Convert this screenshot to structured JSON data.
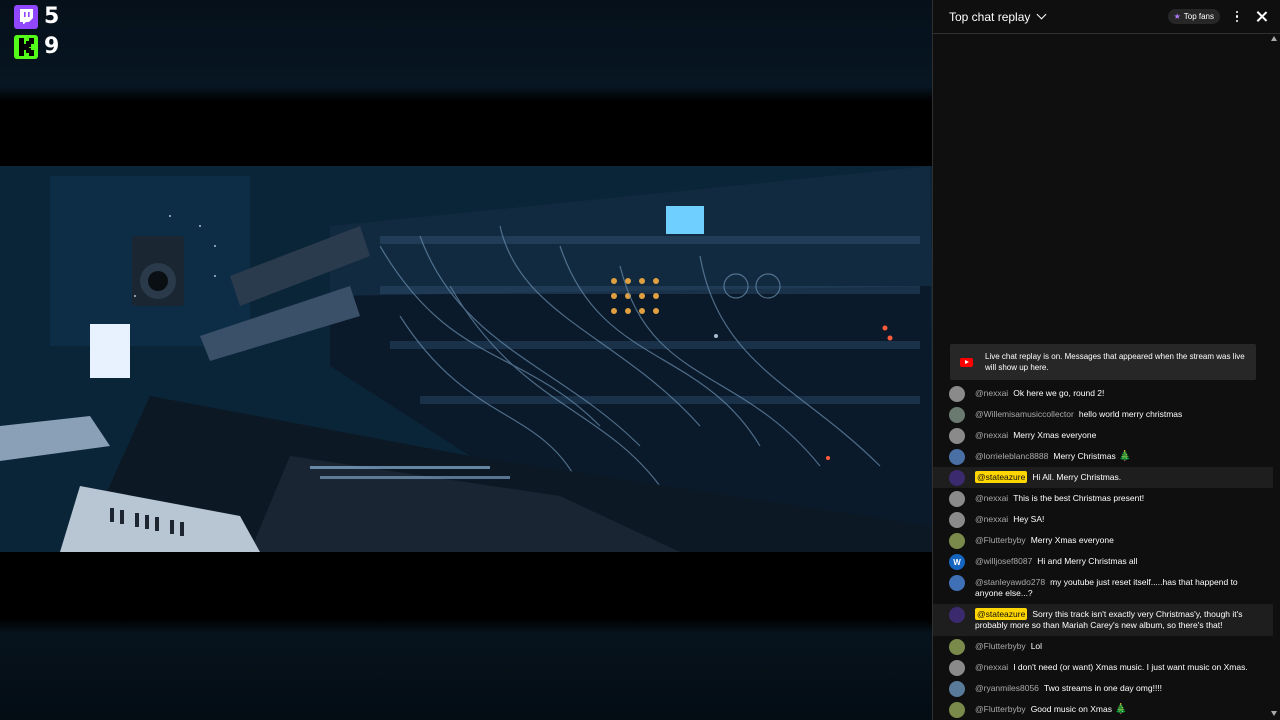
{
  "counters": {
    "twitch": {
      "icon": "twitch-icon",
      "value": "5",
      "color": "#9146ff"
    },
    "kick": {
      "icon": "kick-icon",
      "value": "9",
      "color": "#53fc18"
    }
  },
  "chat": {
    "title": "Top chat replay",
    "top_fans_label": "Top fans",
    "replay_notice": "Live chat replay is on. Messages that appeared when the stream was live will show up here.",
    "messages": [
      {
        "author": "@nexxai",
        "text": "Ok here we go, round 2!",
        "owner": false,
        "tree": false,
        "avatar_color": "#8a8a8a",
        "avatar_letter": ""
      },
      {
        "author": "@Willemisamusiccollector",
        "text": "hello world merry christmas",
        "owner": false,
        "tree": false,
        "avatar_color": "#6b7a70",
        "avatar_letter": ""
      },
      {
        "author": "@nexxai",
        "text": "Merry Xmas everyone",
        "owner": false,
        "tree": false,
        "avatar_color": "#8a8a8a",
        "avatar_letter": ""
      },
      {
        "author": "@lorrieleblanc8888",
        "text": "Merry Christmas",
        "owner": false,
        "tree": true,
        "avatar_color": "#4a6fa5",
        "avatar_letter": ""
      },
      {
        "author": "@stateazure",
        "text": "Hi All. Merry Christmas.",
        "owner": true,
        "tree": false,
        "avatar_color": "#3b2a6e",
        "avatar_letter": ""
      },
      {
        "author": "@nexxai",
        "text": "This is the best Christmas present!",
        "owner": false,
        "tree": false,
        "avatar_color": "#8a8a8a",
        "avatar_letter": ""
      },
      {
        "author": "@nexxai",
        "text": "Hey SA!",
        "owner": false,
        "tree": false,
        "avatar_color": "#8a8a8a",
        "avatar_letter": ""
      },
      {
        "author": "@Flutterbyby",
        "text": "Merry Xmas everyone",
        "owner": false,
        "tree": false,
        "avatar_color": "#7a8a4a",
        "avatar_letter": ""
      },
      {
        "author": "@willjosef8087",
        "text": "Hi and Merry Christmas all",
        "owner": false,
        "tree": false,
        "avatar_color": "#1565c0",
        "avatar_letter": "W"
      },
      {
        "author": "@stanleyawdo278",
        "text": "my youtube just reset itself.....has that happend to anyone else...?",
        "owner": false,
        "tree": false,
        "avatar_color": "#3f6fb5",
        "avatar_letter": ""
      },
      {
        "author": "@stateazure",
        "text": "Sorry this track isn't exactly very Christmas'y, though it's probably more so than Mariah Carey's new album, so there's that!",
        "owner": true,
        "tree": false,
        "avatar_color": "#3b2a6e",
        "avatar_letter": ""
      },
      {
        "author": "@Flutterbyby",
        "text": "Lol",
        "owner": false,
        "tree": false,
        "avatar_color": "#7a8a4a",
        "avatar_letter": ""
      },
      {
        "author": "@nexxai",
        "text": "I don't need (or want) Xmas music. I just want music on Xmas.",
        "owner": false,
        "tree": false,
        "avatar_color": "#8a8a8a",
        "avatar_letter": ""
      },
      {
        "author": "@ryanmiles8056",
        "text": "Two streams in one day omg!!!!",
        "owner": false,
        "tree": false,
        "avatar_color": "#5a7a9a",
        "avatar_letter": ""
      },
      {
        "author": "@Flutterbyby",
        "text": "Good music on Xmas",
        "owner": false,
        "tree": true,
        "avatar_color": "#7a8a4a",
        "avatar_letter": ""
      }
    ]
  }
}
